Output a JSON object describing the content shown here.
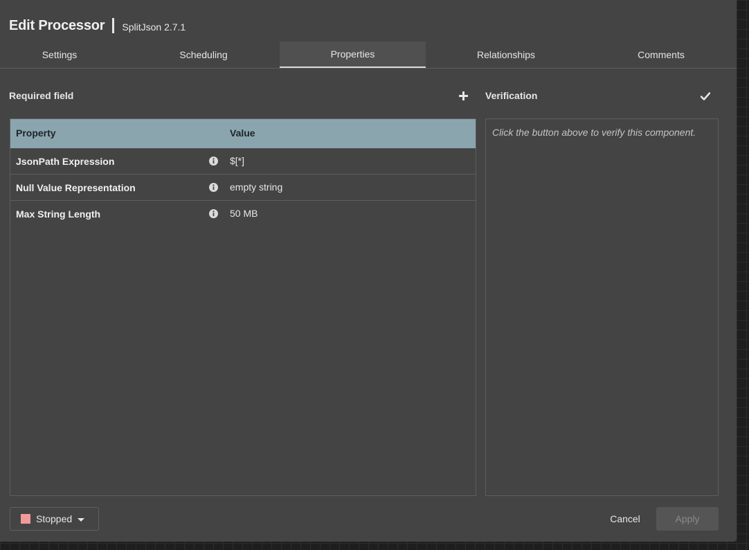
{
  "dialog": {
    "title": "Edit Processor",
    "subtitle": "SplitJson 2.7.1"
  },
  "tabs": [
    {
      "label": "Settings",
      "active": false
    },
    {
      "label": "Scheduling",
      "active": false
    },
    {
      "label": "Properties",
      "active": true
    },
    {
      "label": "Relationships",
      "active": false
    },
    {
      "label": "Comments",
      "active": false
    }
  ],
  "properties": {
    "section_label": "Required field",
    "add_icon": "plus-icon",
    "columns": {
      "property": "Property",
      "value": "Value"
    },
    "header_color": "#8ba5af",
    "rows": [
      {
        "name": "JsonPath Expression",
        "value": "$[*]",
        "info_icon": "info-icon"
      },
      {
        "name": "Null Value Representation",
        "value": "empty string",
        "info_icon": "info-icon"
      },
      {
        "name": "Max String Length",
        "value": "50 MB",
        "info_icon": "info-icon"
      }
    ]
  },
  "verification": {
    "label": "Verification",
    "verify_icon": "checkmark-icon",
    "message": "Click the button above to verify this component."
  },
  "footer": {
    "status_label": "Stopped",
    "status_color": "#f09b9b",
    "cancel_label": "Cancel",
    "apply_label": "Apply"
  }
}
